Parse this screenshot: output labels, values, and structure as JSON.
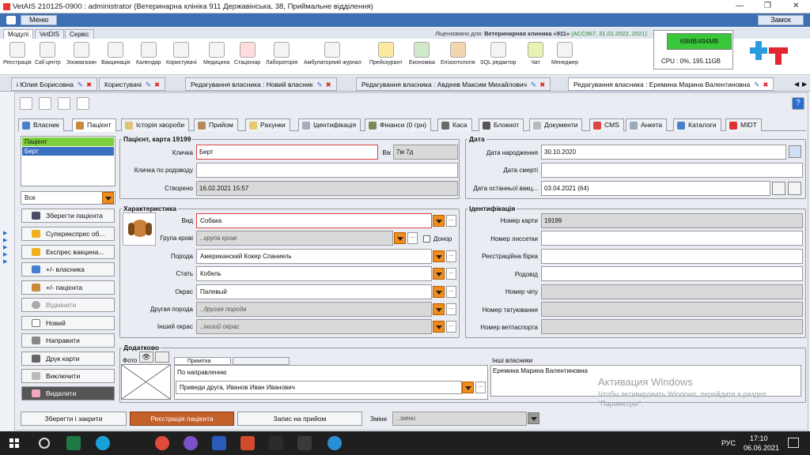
{
  "window": {
    "title": "VetAIS 210125-0900 : administrator (Ветеринарна клініка 911 Державінська, 38, Приймальне відділення)",
    "menu_label": "Меню",
    "close_label": "Замок"
  },
  "ribbon_tabs": [
    "Модулі",
    "VetDIS",
    "Сервіс"
  ],
  "licence": {
    "prefix": "Ліцензовано для:",
    "name": "Ветеринарная клиника «911»",
    "details": "(ACC967, 31.01.2022, 2021)"
  },
  "ribbon_buttons": [
    "Реєстрація",
    "Call центр",
    "Зоомагазин",
    "Вакцинація",
    "Календар",
    "Користувачі",
    "Медицина",
    "Стаціонар",
    "Лабораторія",
    "Амбулаторний журнал",
    "Прейскурант",
    "Економіка",
    "Епізоотологія",
    "SQL редактор",
    "Чат",
    "Менеджер"
  ],
  "status": {
    "memory": "69MB/494MB",
    "cpu": "CPU : 0%, 195.11GB"
  },
  "doc_tabs": [
    "і Юлия Борисовна",
    "Користувачі",
    "Редагування власника : Новий власник",
    "Редагування власника : Авдеев Максим Михайлович",
    "Редагування власника : Еремина Марина Валентиновна"
  ],
  "patient_tabs": [
    "Власник",
    "Пацієнт",
    "Історія хвороби",
    "Прийом",
    "Рахунки",
    "Ідентифікація",
    "Фінанси (0 грн)",
    "Каса",
    "Блокнот",
    "Документи",
    "CMS",
    "Анкета",
    "Каталоги",
    "MIDT"
  ],
  "left_list": {
    "items": [
      "Пацієнт",
      "Берт"
    ],
    "filter": "Все"
  },
  "left_buttons": [
    "Зберегти пацієнта",
    "Суперекспрес об...",
    "Експрес вакцина...",
    "+/- власника",
    "+/- пацієнта",
    "Відмінити",
    "Новий",
    "Направити",
    "Друк карти",
    "Виключити",
    "Видалити"
  ],
  "patient_card": {
    "title": "Пацієнт, карта 19199",
    "nickname_label": "Кличка",
    "nickname": "Берт",
    "age_label": "Вік",
    "age": "7м 7д",
    "pedigree_label": "Кличка по родоводу",
    "pedigree": "",
    "created_label": "Створено",
    "created": "16.02.2021 15:57"
  },
  "dates": {
    "title": "Дата",
    "birth_label": "Дата народження",
    "birth": "30.10.2020",
    "death_label": "Дата смерті",
    "death": "",
    "vacc_label": "Дата останньої вакц...",
    "vacc": "03.04.2021 (64)"
  },
  "characteristics": {
    "title": "Характеристика",
    "species_label": "Вид",
    "species": "Собака",
    "bloodgroup_label": "Група крові",
    "bloodgroup": "..група крові",
    "donor_label": "Донор",
    "breed_label": "Порода",
    "breed": "Американский Кокер Спаниель",
    "sex_label": "Стать",
    "sex": "Кобель",
    "color_label": "Окрас",
    "color": "Палевый",
    "other_breed_label": "Другая порода",
    "other_breed": "..другая порода",
    "other_color_label": "Інший окрас",
    "other_color": "..інший окрас"
  },
  "identification": {
    "title": "Ідентифікація",
    "card_no_label": "Номер карти",
    "card_no": "19199",
    "collar_label": "Номер лиссетки",
    "ear_tag_label": "Реєстраційна бірка",
    "pedigree_label": "Родовід",
    "chip_label": "Номер чіпу",
    "tattoo_label": "Номер татуювання",
    "passport_label": "Номер ветпаспорта"
  },
  "extra": {
    "title": "Додатково",
    "photo_label": "Фото",
    "note_tab": "Примітка",
    "direction_label": "По направленню",
    "direction": "Приведи друга, Иванов Иван Иванович",
    "other_owners_label": "Інші власники",
    "other_owner": "Еремина Марина Валентиновна"
  },
  "bottom": {
    "save_close": "Зберегти і закрити",
    "register": "Реєстрація пацієнта",
    "appointment": "Запис на прийом",
    "changes_label": "Зміни",
    "changes": "..зміни"
  },
  "watermark": {
    "line1": "Активация Windows",
    "line2": "Чтобы активировать Windows, перейдите в раздел \"Параметры\"."
  },
  "taskbar": {
    "lang": "РУС",
    "time": "17:10",
    "date": "06.06.2021"
  }
}
